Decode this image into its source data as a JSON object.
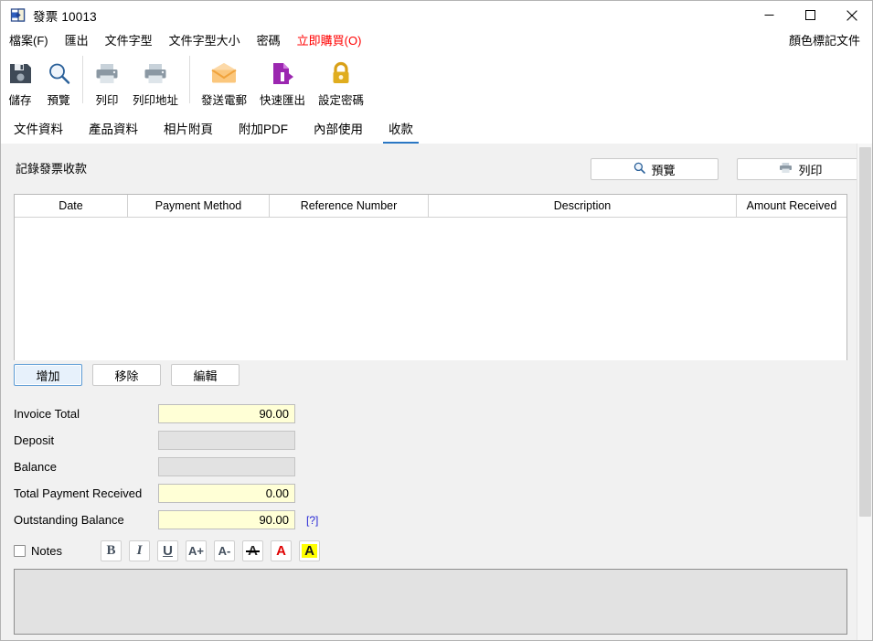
{
  "window": {
    "title": "發票 10013",
    "title_icon": "invoice-window-icon",
    "minimize_label": "─",
    "maximize_label": "□",
    "close_label": "✕"
  },
  "menubar": {
    "items": [
      {
        "label": "檔案(F)",
        "name": "menu-file"
      },
      {
        "label": "匯出",
        "name": "menu-export"
      },
      {
        "label": "文件字型",
        "name": "menu-document-font"
      },
      {
        "label": "文件字型大小",
        "name": "menu-document-font-size"
      },
      {
        "label": "密碼",
        "name": "menu-password"
      },
      {
        "label": "立即購買(O)",
        "name": "menu-buy-now"
      }
    ],
    "right_item": "顏色標記文件"
  },
  "toolbar": {
    "buttons": [
      {
        "label": "儲存",
        "icon": "save-floppy-icon"
      },
      {
        "label": "預覽",
        "icon": "preview-magnifier-icon"
      },
      {
        "label": "列印",
        "icon": "print-printer-icon"
      },
      {
        "label": "列印地址",
        "icon": "print-address-printer-icon"
      },
      {
        "label": "發送電郵",
        "icon": "send-email-envelope-icon"
      },
      {
        "label": "快速匯出",
        "icon": "quick-export-document-icon"
      },
      {
        "label": "設定密碼",
        "icon": "set-password-lock-icon"
      }
    ]
  },
  "tabs": [
    {
      "label": "文件資料",
      "active": false
    },
    {
      "label": "產品資料",
      "active": false
    },
    {
      "label": "相片附頁",
      "active": false
    },
    {
      "label": "附加PDF",
      "active": false
    },
    {
      "label": "內部使用",
      "active": false
    },
    {
      "label": "收款",
      "active": true
    }
  ],
  "section": {
    "title": "記錄發票收款",
    "preview_button": "預覽",
    "print_button": "列印"
  },
  "payments_table": {
    "columns": [
      "Date",
      "Payment Method",
      "Reference Number",
      "Description",
      "Amount Received"
    ],
    "rows": []
  },
  "actions": {
    "add": "增加",
    "remove": "移除",
    "edit": "編輯"
  },
  "totals": {
    "rows": [
      {
        "label": "Invoice Total",
        "value": "90.00",
        "disabled": false
      },
      {
        "label": "Deposit",
        "value": "",
        "disabled": true
      },
      {
        "label": "Balance",
        "value": "",
        "disabled": true
      },
      {
        "label": "Total Payment Received",
        "value": "0.00",
        "disabled": false
      },
      {
        "label": "Outstanding Balance",
        "value": "90.00",
        "disabled": false
      }
    ],
    "help_link": "[?]"
  },
  "notes": {
    "checkbox_label": "Notes",
    "checked": false,
    "value": "",
    "format_buttons": [
      {
        "name": "bold-button",
        "label": "B"
      },
      {
        "name": "italic-button",
        "label": "I"
      },
      {
        "name": "underline-button",
        "label": "U"
      },
      {
        "name": "increase-font-size-button",
        "label": "A+"
      },
      {
        "name": "decrease-font-size-button",
        "label": "A-"
      },
      {
        "name": "strikethrough-button",
        "label": "A"
      },
      {
        "name": "font-color-button",
        "label": "A"
      },
      {
        "name": "highlight-color-button",
        "label": "A"
      }
    ]
  },
  "colors": {
    "accent": "#2a77c4",
    "buy_now": "#ff0000",
    "field_editable": "#ffffd6",
    "field_disabled": "#e2e2e2",
    "link": "#2a2ad6",
    "highlight": "#ffff00"
  }
}
